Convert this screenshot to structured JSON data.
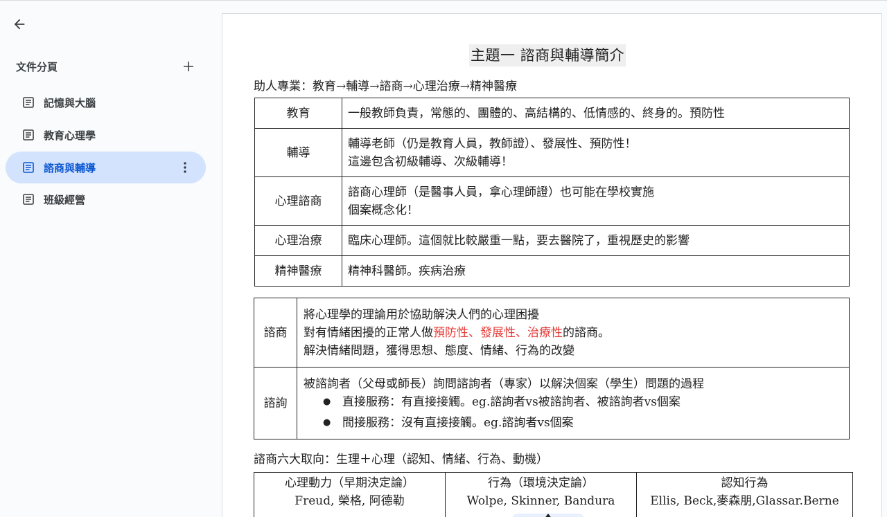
{
  "sidebar": {
    "tabs_title": "文件分頁",
    "items": [
      {
        "label": "記憶與大腦"
      },
      {
        "label": "教育心理學"
      },
      {
        "label": "諮商與輔導"
      },
      {
        "label": "班級經營"
      }
    ]
  },
  "doc": {
    "title": "主題一 諮商與輔導簡介",
    "intro": "助人專業：教育→輔導→諮商→心理治療→精神醫療",
    "table1": [
      {
        "key": "教育",
        "lines": [
          "一般教師負責，常態的、團體的、高結構的、低情感的、終身的。預防性"
        ]
      },
      {
        "key": "輔導",
        "lines": [
          "輔導老師（仍是教育人員，教師證）、發展性、預防性！",
          "這邊包含初級輔導、次級輔導！"
        ]
      },
      {
        "key": "心理諮商",
        "lines": [
          "諮商心理師（是醫事人員，拿心理師證）也可能在學校實施",
          "個案概念化！"
        ]
      },
      {
        "key": "心理治療",
        "lines": [
          "臨床心理師。這個就比較嚴重一點，要去醫院了，重視歷史的影響"
        ]
      },
      {
        "key": "精神醫療",
        "lines": [
          "精神科醫師。疾病治療"
        ]
      }
    ],
    "table2": {
      "row1": {
        "key": "諮商",
        "line1": "將心理學的理論用於協助解決人們的心理困擾",
        "line2_pre": "對有情緒困擾的正常人做",
        "line2_red": "預防性、發展性、治療性",
        "line2_post": "的諮商。",
        "line3": "解決情緒問題，獲得思想、態度、情緒、行為的改變"
      },
      "row2": {
        "key": "諮詢",
        "line1": "被諮詢者（父母或師長）詢問諮詢者（專家）以解決個案（學生）問題的過程",
        "bullets": [
          "直接服務：有直接接觸。eg.諮詢者vs被諮詢者、被諮詢者vs個案",
          "間接服務：沒有直接接觸。eg.諮詢者vs個案"
        ]
      }
    },
    "six_title": "諮商六大取向：生理＋心理（認知、情緒、行為、動機）",
    "table3": [
      {
        "head": "心理動力（早期決定論）",
        "names": "Freud, 榮格, 阿德勒"
      },
      {
        "head": "行為（環境決定論）",
        "names": "Wolpe, Skinner, Bandura"
      },
      {
        "head": "認知行為",
        "names": "Ellis, Beck,麥森朋,Glassar.Berne"
      }
    ]
  },
  "colors": {
    "accent": "#0b57d0",
    "active_bg": "#d3e3fd",
    "highlight_red": "#e53935"
  },
  "icons": [
    "back-arrow-icon",
    "plus-icon",
    "document-icon",
    "more-vert-icon"
  ]
}
